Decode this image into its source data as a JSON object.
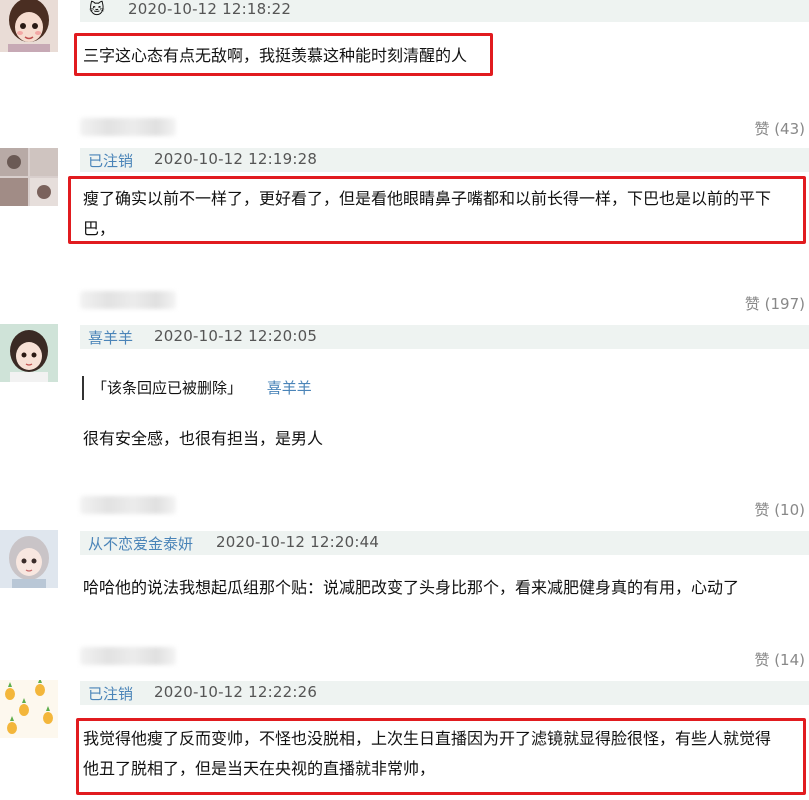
{
  "comments": [
    {
      "username": "",
      "timestamp": "2020-10-12 12:18:22",
      "text": "三字这心态有点无敌啊，我挺羡慕这种能时刻清醒的人",
      "likes": "赞 (43)",
      "avatar_icon": "girl-avatar-icon",
      "name_icon": "cat-emoji-icon"
    },
    {
      "username": "已注销",
      "timestamp": "2020-10-12 12:19:28",
      "text_line1": "瘦了确实以前不一样了，更好看了，但是看他眼睛鼻子嘴都和以前长得一样，下巴也是以前的平下",
      "text_line2": "巴，",
      "likes": "赞 (197)",
      "avatar_icon": "collage-avatar-icon"
    },
    {
      "username": "喜羊羊",
      "timestamp": "2020-10-12 12:20:05",
      "quote_text": "「该条回应已被删除」",
      "quote_user": "喜羊羊",
      "text": "很有安全感，也很有担当，是男人",
      "likes": "赞 (10)",
      "avatar_icon": "girl-avatar-icon"
    },
    {
      "username": "从不恋爱金泰妍",
      "timestamp": "2020-10-12 12:20:44",
      "text": "哈哈他的说法我想起瓜组那个贴：说减肥改变了头身比那个，看来减肥健身真的有用，心动了",
      "likes": "赞 (14)",
      "avatar_icon": "girl-avatar-icon"
    },
    {
      "username": "已注销",
      "timestamp": "2020-10-12 12:22:26",
      "text_line1": "我觉得他瘦了反而变帅，不怪也没脱相，上次生日直播因为开了滤镜就显得脸很怪，有些人就觉得",
      "text_line2": "他丑了脱相了，但是当天在央视的直播就非常帅，",
      "avatar_icon": "pineapple-avatar-icon"
    }
  ],
  "colors": {
    "highlight": "#e11b1f",
    "username": "#4a84b8",
    "header_bg": "#eef3f1"
  }
}
